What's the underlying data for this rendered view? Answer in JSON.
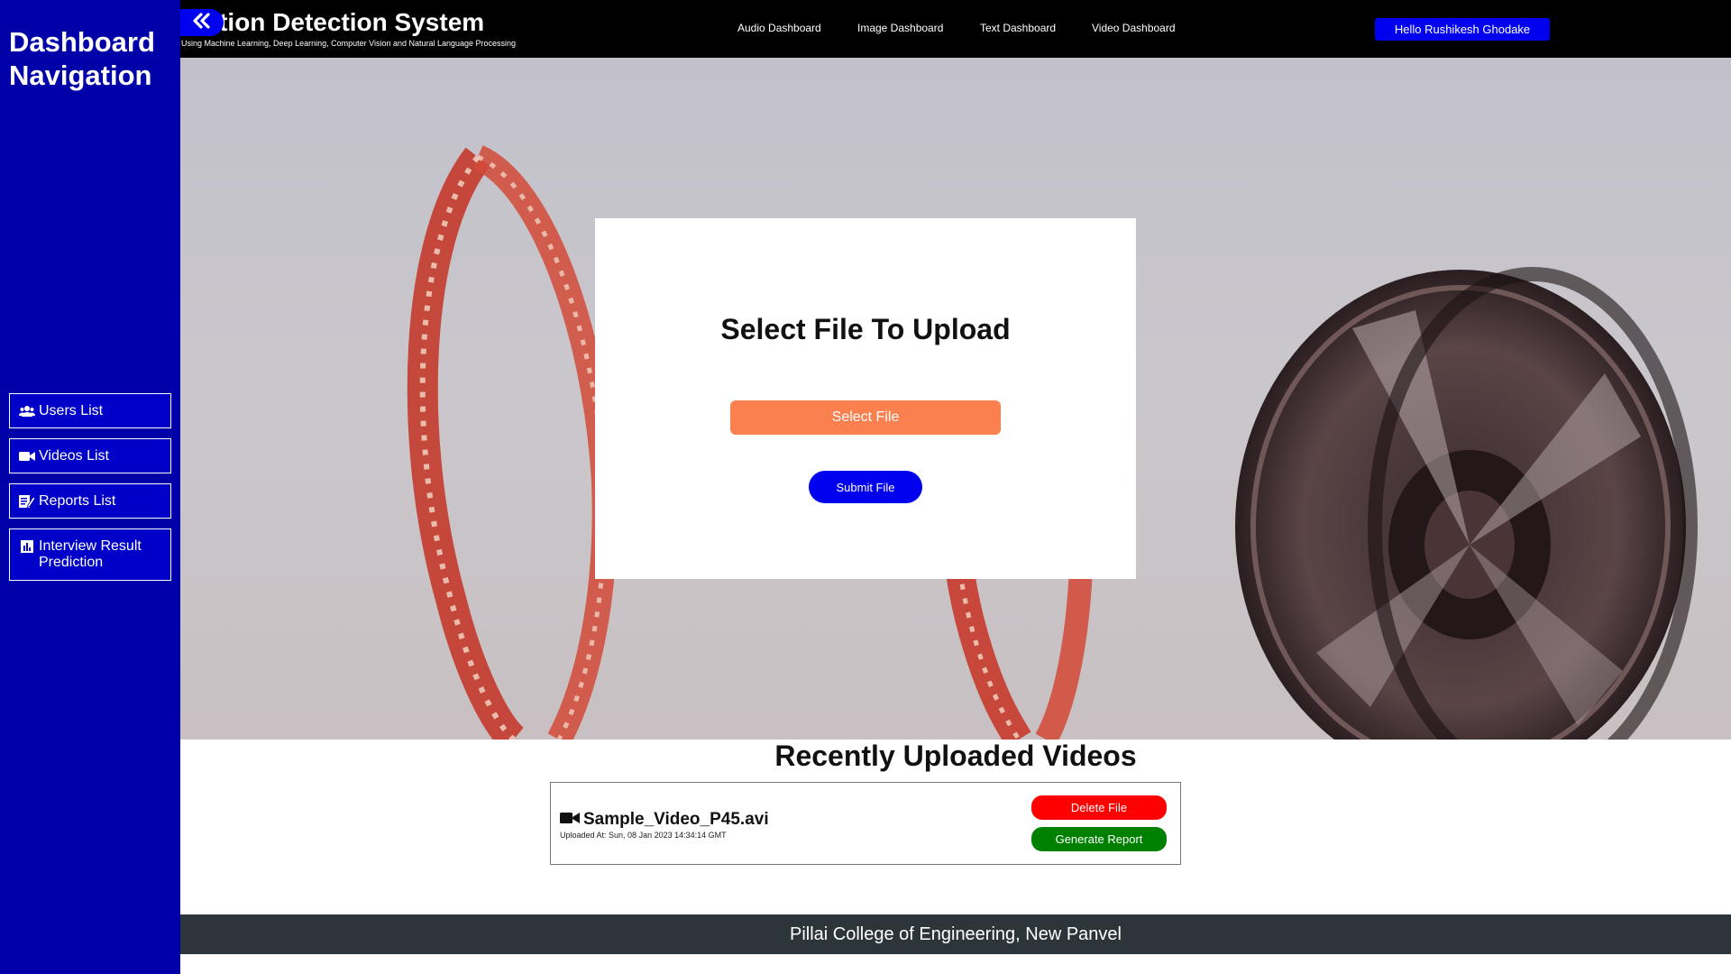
{
  "sidebar": {
    "title": "Dashboard Navigation",
    "items": [
      {
        "label": "Users List",
        "icon": "users-icon"
      },
      {
        "label": "Videos List",
        "icon": "video-camera-icon"
      },
      {
        "label": "Reports List",
        "icon": "edit-document-icon"
      },
      {
        "label": "Interview Result Prediction",
        "icon": "bar-chart-icon"
      }
    ]
  },
  "header": {
    "title": "otion Detection System",
    "subtitle": "Using Machine Learning, Deep Learning, Computer Vision and Natural Language Processing",
    "nav": [
      "Audio Dashboard",
      "Image Dashboard",
      "Text Dashboard",
      "Video Dashboard"
    ],
    "user_greeting": "Hello Rushikesh Ghodake"
  },
  "upload": {
    "title": "Select File To Upload",
    "select_label": "Select File",
    "submit_label": "Submit File"
  },
  "recent": {
    "heading": "Recently Uploaded Videos",
    "videos": [
      {
        "name": "Sample_Video_P45.avi",
        "uploaded_at": "Uploaded At: Sun, 08 Jan 2023 14:34:14 GMT",
        "delete_label": "Delete File",
        "report_label": "Generate Report"
      }
    ]
  },
  "footer": {
    "text": "Pillai College of Engineering, New Panvel"
  },
  "colors": {
    "sidebar_bg": "#0000a8",
    "primary_blue": "#0000ee",
    "select_orange": "#fb8050",
    "delete_red": "#ff0000",
    "report_green": "#008000",
    "footer_bg": "#2c3539"
  }
}
